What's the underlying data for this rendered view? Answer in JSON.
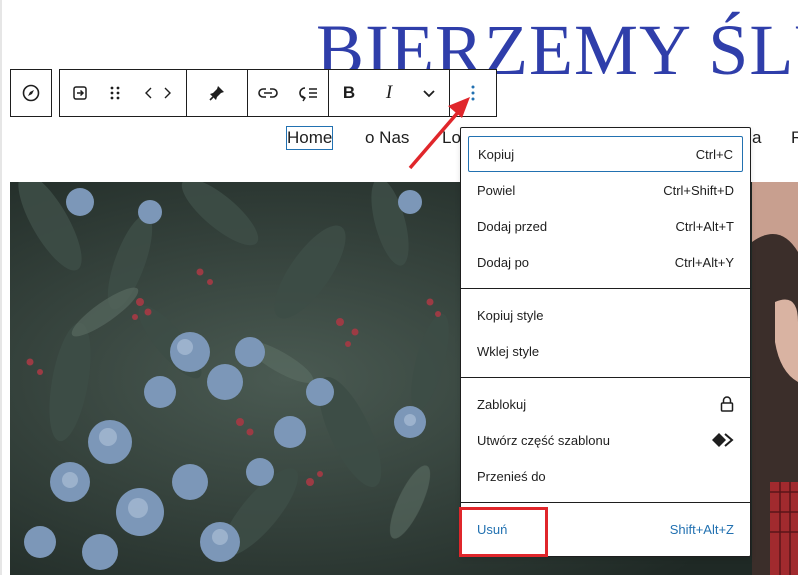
{
  "site": {
    "title": "BIERZEMY ŚLUB"
  },
  "colors": {
    "accent": "#2271b1",
    "title_blue": "#2f3eaa",
    "annotation_red": "#e0262b"
  },
  "toolbar": {
    "icons": [
      "compass-icon",
      "select-parent-icon",
      "drag-handle-icon",
      "move-arrows-icon",
      "pin-icon",
      "link-icon",
      "submenu-icon",
      "bold-icon",
      "italic-icon",
      "chevron-down-icon",
      "more-options-icon"
    ],
    "bold": "B",
    "italic": "I"
  },
  "nav": {
    "items": [
      "Home",
      "o Nas",
      "Lo",
      "a",
      "R"
    ]
  },
  "menu": {
    "sections": [
      {
        "items": [
          {
            "label": "Kopiuj",
            "shortcut": "Ctrl+C"
          },
          {
            "label": "Powiel",
            "shortcut": "Ctrl+Shift+D"
          },
          {
            "label": "Dodaj przed",
            "shortcut": "Ctrl+Alt+T"
          },
          {
            "label": "Dodaj po",
            "shortcut": "Ctrl+Alt+Y"
          }
        ]
      },
      {
        "items": [
          {
            "label": "Kopiuj style"
          },
          {
            "label": "Wklej style"
          }
        ]
      },
      {
        "items": [
          {
            "label": "Zablokuj",
            "icon": "lock-icon"
          },
          {
            "label": "Utwórz część szablonu",
            "icon": "template-part-icon"
          },
          {
            "label": "Przenieś do"
          }
        ]
      },
      {
        "items": [
          {
            "label": "Usuń",
            "shortcut": "Shift+Alt+Z"
          }
        ]
      }
    ]
  }
}
